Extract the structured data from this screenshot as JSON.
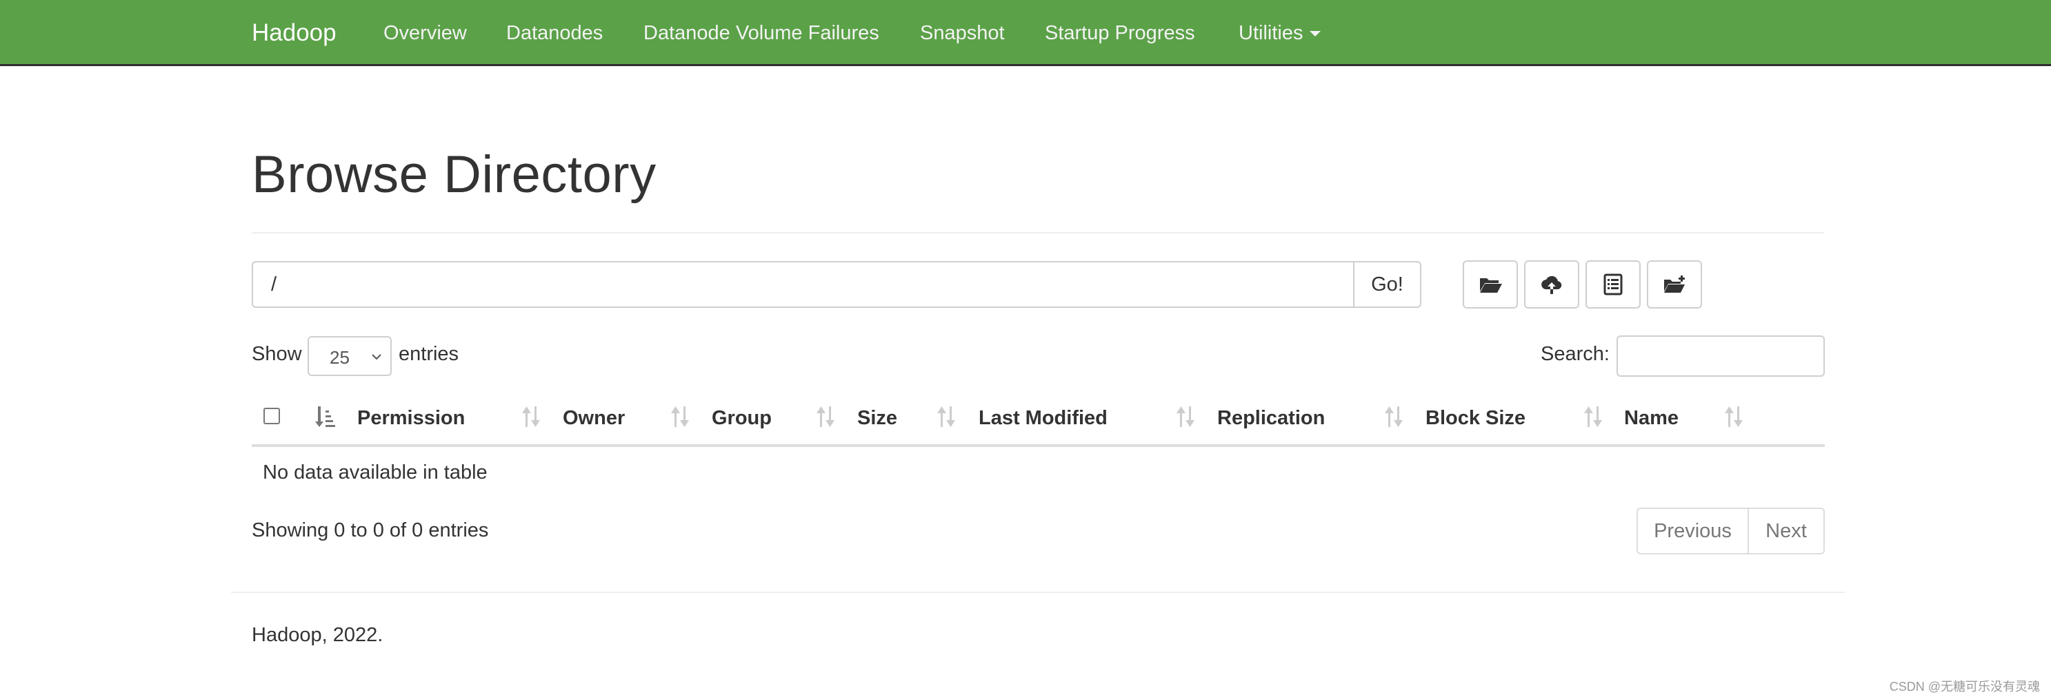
{
  "navbar": {
    "brand": "Hadoop",
    "links": [
      "Overview",
      "Datanodes",
      "Datanode Volume Failures",
      "Snapshot",
      "Startup Progress",
      "Utilities"
    ],
    "color": "#5ba148"
  },
  "page": {
    "title": "Browse Directory"
  },
  "path_bar": {
    "value": "/",
    "go_label": "Go!"
  },
  "toolbar": {
    "icons": [
      "folder-open-icon",
      "cloud-upload-icon",
      "list-alt-icon",
      "new-folder-icon"
    ]
  },
  "table_controls": {
    "show_label": "Show",
    "page_length": "25",
    "entries_label": "entries",
    "search_label": "Search:"
  },
  "table": {
    "columns": [
      "Permission",
      "Owner",
      "Group",
      "Size",
      "Last Modified",
      "Replication",
      "Block Size",
      "Name"
    ],
    "empty_message": "No data available in table"
  },
  "pagination": {
    "info": "Showing 0 to 0 of 0 entries",
    "previous": "Previous",
    "next": "Next"
  },
  "footer": {
    "text": "Hadoop, 2022."
  },
  "watermark": "CSDN @无糖可乐没有灵魂"
}
